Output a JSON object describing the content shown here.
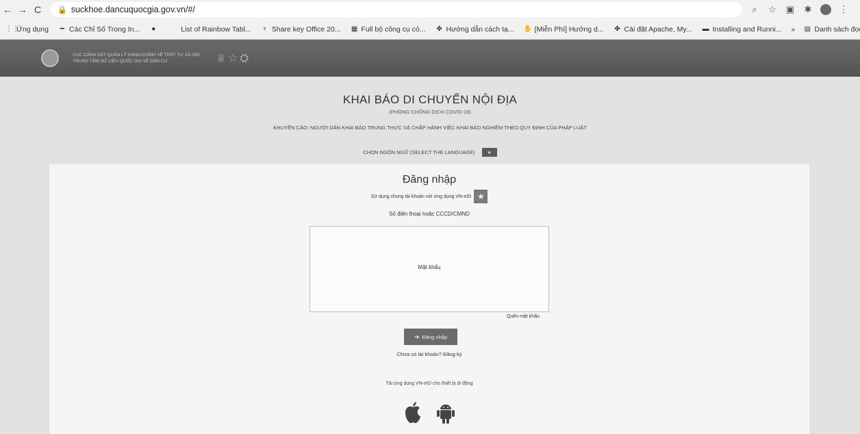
{
  "browser": {
    "url": "suckhoe.dancuquocgia.gov.vn/#/",
    "bookmarks": [
      {
        "label": "Ứng dụng",
        "icon": "apps-grid-icon"
      },
      {
        "label": "Các Chỉ Số Trong In...",
        "icon": "dash-icon"
      },
      {
        "label": "",
        "icon": "github-icon"
      },
      {
        "label": "List of Rainbow Tabl...",
        "icon": "page-icon"
      },
      {
        "label": "Share key Office 20...",
        "icon": "trophy-icon"
      },
      {
        "label": "Full bộ công cụ có...",
        "icon": "grid-icon"
      },
      {
        "label": "Hướng dẫn cách tạ...",
        "icon": "kotlin-icon"
      },
      {
        "label": "[Miễn Phí] Hướng d...",
        "icon": "hand-icon"
      },
      {
        "label": "Cài đặt Apache, My...",
        "icon": "kotlin-icon"
      },
      {
        "label": "Installing and Runni...",
        "icon": "video-icon"
      }
    ],
    "more": "»",
    "reading_list": "Danh sách đọc"
  },
  "header": {
    "org_line1": "CỤC CẢNH SÁT QUẢN LÝ HÀNH CHÍNH VỀ TRẬT TỰ XÃ HỘI",
    "org_line2": "TRUNG TÂM DỮ LIỆU QUỐC GIA VỀ DÂN CƯ"
  },
  "page": {
    "title": "KHAI BÁO DI CHUYỂN NỘI ĐỊA",
    "subtitle": "(PHÒNG CHỐNG DỊCH COVID-19)",
    "warning": "KHUYẾN CÁO: NGƯỜI DÂN KHAI BÁO TRUNG THỰC VÀ CHẤP HÀNH VIỆC KHAI BÁO NGHIÊM THEO QUY ĐỊNH CỦA PHÁP LUẬT",
    "language_label": "CHỌN NGÔN NGỮ (SELECT THE LANGUAGE)"
  },
  "login": {
    "title": "Đăng nhập",
    "vneid_text": "Sử dụng chung tài khoản với ứng dụng VN-eID",
    "id_label": "Số điện thoại hoặc CCCD/CMND",
    "password_label": "Mật khẩu",
    "forgot": "Quên mật khẩu",
    "button": "Đăng nhập",
    "register": "Chưa có tài khoản? Đăng ký",
    "download": "Tải ứng dụng VN-eID cho thiết bị di động"
  },
  "colors": {
    "header_bg": "#5e5e5e",
    "button_bg": "#6b6b6b"
  }
}
